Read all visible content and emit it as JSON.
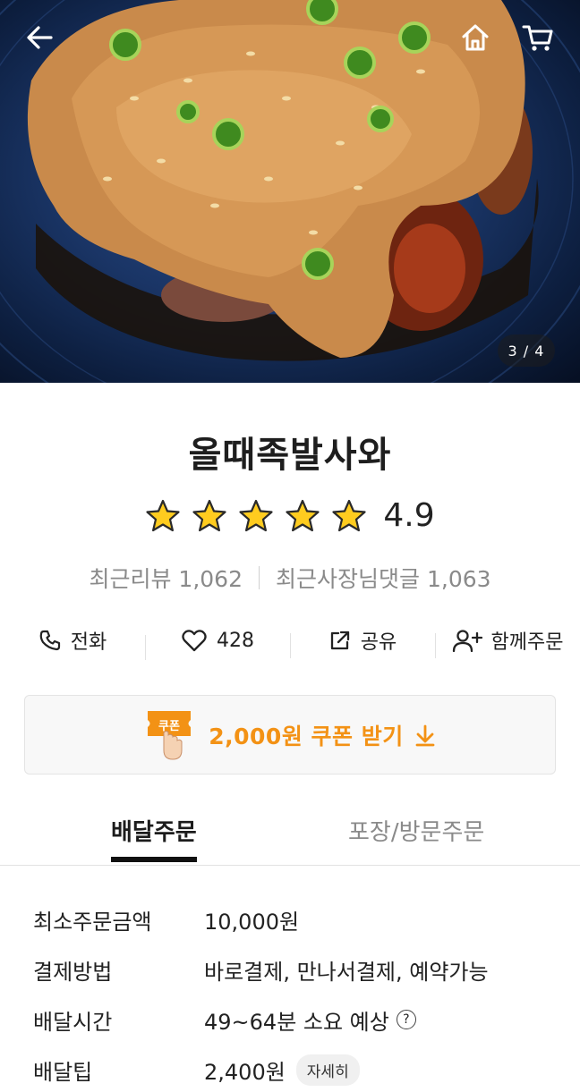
{
  "header": {
    "back_icon": "arrow-left-icon",
    "home_icon": "home-icon",
    "cart_icon": "cart-icon",
    "image_counter": "3 / 4"
  },
  "store": {
    "name": "올때족발사와",
    "rating": "4.9",
    "rating_stars": 5,
    "recent_reviews_label": "최근리뷰",
    "recent_reviews_count": "1,062",
    "owner_replies_label": "최근사장님댓글",
    "owner_replies_count": "1,063"
  },
  "actions": {
    "call_label": "전화",
    "like_count": "428",
    "share_label": "공유",
    "group_order_label": "함께주문"
  },
  "coupon": {
    "badge_text": "쿠폰",
    "label": "2,000원 쿠폰 받기",
    "accent_color": "#f39215"
  },
  "tabs": {
    "delivery": "배달주문",
    "pickup": "포장/방문주문"
  },
  "details": {
    "min_order_label": "최소주문금액",
    "min_order_value": "10,000원",
    "payment_label": "결제방법",
    "payment_value": "바로결제, 만나서결제, 예약가능",
    "delivery_time_label": "배달시간",
    "delivery_time_value": "49~64분 소요 예상",
    "delivery_tip_label": "배달팁",
    "delivery_tip_value": "2,400원",
    "detail_button": "자세히"
  }
}
